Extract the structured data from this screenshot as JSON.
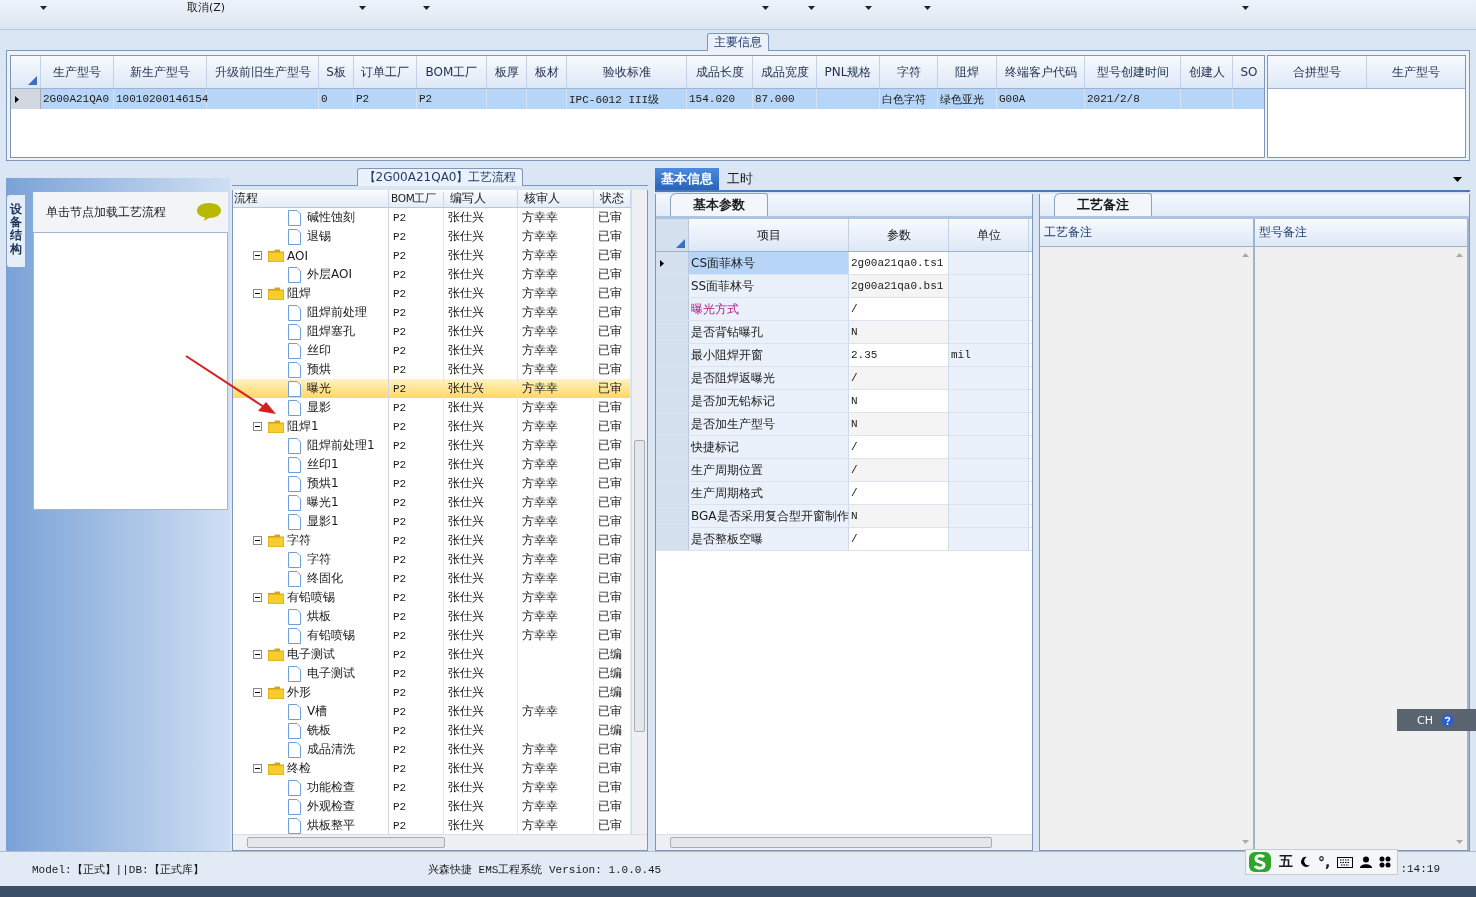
{
  "toolbar": {
    "cancel_label": "取消(Z)"
  },
  "main_info": {
    "title": "主要信息",
    "columns": [
      "生产型号",
      "新生产型号",
      "升级前旧生产型号",
      "S板",
      "订单工厂",
      "BOM工厂",
      "板厚",
      "板材",
      "验收标准",
      "成品长度",
      "成品宽度",
      "PNL规格",
      "字符",
      "阻焊",
      "终端客户代码",
      "型号创建时间",
      "创建人",
      "SO"
    ],
    "rows": [
      {
        "selected": true,
        "cells": [
          "2G00A21QA0",
          "10010200146154",
          null,
          "0",
          "P2",
          "P2",
          null,
          null,
          "IPC-6012 III级",
          "154.020",
          "87.000",
          null,
          "白色字符",
          "绿色亚光",
          "G00A",
          "2021/2/8",
          null,
          null
        ]
      }
    ],
    "merge_columns": [
      "合拼型号",
      "生产型号"
    ]
  },
  "left_panel": {
    "vertical_tab": "设备结构",
    "hint": "单击节点加载工艺流程"
  },
  "process_tree": {
    "title": "【2G00A21QA0】工艺流程",
    "columns": [
      "流程",
      "BOM工厂",
      "编写人",
      "核审人",
      "状态"
    ],
    "nodes": [
      {
        "name": "碱性蚀刻",
        "bom_factory": "P2",
        "writer": "张仕兴",
        "reviewer": "方幸幸",
        "status": "已审",
        "selected": false
      },
      {
        "name": "退锡",
        "bom_factory": "P2",
        "writer": "张仕兴",
        "reviewer": "方幸幸",
        "status": "已审",
        "selected": false
      },
      {
        "name": "AOI",
        "bom_factory": "P2",
        "writer": "张仕兴",
        "reviewer": "方幸幸",
        "status": "已审",
        "selected": false,
        "expanded": true,
        "children": [
          {
            "name": "外层AOI",
            "bom_factory": "P2",
            "writer": "张仕兴",
            "reviewer": "方幸幸",
            "status": "已审",
            "selected": false
          }
        ]
      },
      {
        "name": "阻焊",
        "bom_factory": "P2",
        "writer": "张仕兴",
        "reviewer": "方幸幸",
        "status": "已审",
        "selected": false,
        "expanded": true,
        "children": [
          {
            "name": "阻焊前处理",
            "bom_factory": "P2",
            "writer": "张仕兴",
            "reviewer": "方幸幸",
            "status": "已审",
            "selected": false
          },
          {
            "name": "阻焊塞孔",
            "bom_factory": "P2",
            "writer": "张仕兴",
            "reviewer": "方幸幸",
            "status": "已审",
            "selected": false
          },
          {
            "name": "丝印",
            "bom_factory": "P2",
            "writer": "张仕兴",
            "reviewer": "方幸幸",
            "status": "已审",
            "selected": false
          },
          {
            "name": "预烘",
            "bom_factory": "P2",
            "writer": "张仕兴",
            "reviewer": "方幸幸",
            "status": "已审",
            "selected": false
          },
          {
            "name": "曝光",
            "bom_factory": "P2",
            "writer": "张仕兴",
            "reviewer": "方幸幸",
            "status": "已审",
            "selected": true
          },
          {
            "name": "显影",
            "bom_factory": "P2",
            "writer": "张仕兴",
            "reviewer": "方幸幸",
            "status": "已审",
            "selected": false
          }
        ]
      },
      {
        "name": "阻焊1",
        "bom_factory": "P2",
        "writer": "张仕兴",
        "reviewer": "方幸幸",
        "status": "已审",
        "selected": false,
        "expanded": true,
        "children": [
          {
            "name": "阻焊前处理1",
            "bom_factory": "P2",
            "writer": "张仕兴",
            "reviewer": "方幸幸",
            "status": "已审",
            "selected": false
          },
          {
            "name": "丝印1",
            "bom_factory": "P2",
            "writer": "张仕兴",
            "reviewer": "方幸幸",
            "status": "已审",
            "selected": false
          },
          {
            "name": "预烘1",
            "bom_factory": "P2",
            "writer": "张仕兴",
            "reviewer": "方幸幸",
            "status": "已审",
            "selected": false
          },
          {
            "name": "曝光1",
            "bom_factory": "P2",
            "writer": "张仕兴",
            "reviewer": "方幸幸",
            "status": "已审",
            "selected": false
          },
          {
            "name": "显影1",
            "bom_factory": "P2",
            "writer": "张仕兴",
            "reviewer": "方幸幸",
            "status": "已审",
            "selected": false
          }
        ]
      },
      {
        "name": "字符",
        "bom_factory": "P2",
        "writer": "张仕兴",
        "reviewer": "方幸幸",
        "status": "已审",
        "selected": false,
        "expanded": true,
        "children": [
          {
            "name": "字符",
            "bom_factory": "P2",
            "writer": "张仕兴",
            "reviewer": "方幸幸",
            "status": "已审",
            "selected": false
          },
          {
            "name": "终固化",
            "bom_factory": "P2",
            "writer": "张仕兴",
            "reviewer": "方幸幸",
            "status": "已审",
            "selected": false
          }
        ]
      },
      {
        "name": "有铅喷锡",
        "bom_factory": "P2",
        "writer": "张仕兴",
        "reviewer": "方幸幸",
        "status": "已审",
        "selected": false,
        "expanded": true,
        "children": [
          {
            "name": "烘板",
            "bom_factory": "P2",
            "writer": "张仕兴",
            "reviewer": "方幸幸",
            "status": "已审",
            "selected": false
          },
          {
            "name": "有铅喷锡",
            "bom_factory": "P2",
            "writer": "张仕兴",
            "reviewer": "方幸幸",
            "status": "已审",
            "selected": false
          }
        ]
      },
      {
        "name": "电子测试",
        "bom_factory": "P2",
        "writer": "张仕兴",
        "status": "已编",
        "selected": false,
        "expanded": true,
        "children": [
          {
            "name": "电子测试",
            "bom_factory": "P2",
            "writer": "张仕兴",
            "status": "已编",
            "selected": false
          }
        ]
      },
      {
        "name": "外形",
        "bom_factory": "P2",
        "writer": "张仕兴",
        "status": "已编",
        "selected": false,
        "expanded": true,
        "children": [
          {
            "name": "V槽",
            "bom_factory": "P2",
            "writer": "张仕兴",
            "reviewer": "方幸幸",
            "status": "已审",
            "selected": false
          },
          {
            "name": "铣板",
            "bom_factory": "P2",
            "writer": "张仕兴",
            "status": "已编",
            "selected": false
          },
          {
            "name": "成品清洗",
            "bom_factory": "P2",
            "writer": "张仕兴",
            "reviewer": "方幸幸",
            "status": "已审",
            "selected": false
          }
        ]
      },
      {
        "name": "终检",
        "bom_factory": "P2",
        "writer": "张仕兴",
        "reviewer": "方幸幸",
        "status": "已审",
        "selected": false,
        "expanded": true,
        "children": [
          {
            "name": "功能检查",
            "bom_factory": "P2",
            "writer": "张仕兴",
            "reviewer": "方幸幸",
            "status": "已审",
            "selected": false
          },
          {
            "name": "外观检查",
            "bom_factory": "P2",
            "writer": "张仕兴",
            "reviewer": "方幸幸",
            "status": "已审",
            "selected": false
          },
          {
            "name": "烘板整平",
            "bom_factory": "P2",
            "writer": "张仕兴",
            "reviewer": "方幸幸",
            "status": "已审",
            "selected": false
          }
        ]
      }
    ]
  },
  "detail_tabs": [
    {
      "label": "基本信息",
      "selected": true
    },
    {
      "label": "工时",
      "selected": false
    }
  ],
  "basic_params": {
    "tab": "基本参数",
    "columns": [
      "项目",
      "参数",
      "单位"
    ],
    "rows": [
      {
        "item": "CS面菲林号",
        "value": "2g00a21qa0.ts1",
        "selected": true,
        "highlighted": false
      },
      {
        "item": "SS面菲林号",
        "value": "2g00a21qa0.bs1",
        "selected": false,
        "highlighted": false
      },
      {
        "item": "曝光方式",
        "value": "/",
        "selected": false,
        "highlighted": true
      },
      {
        "item": "是否背钻曝孔",
        "value": "N",
        "selected": false,
        "highlighted": false
      },
      {
        "item": "最小阻焊开窗",
        "value": "2.35",
        "unit": "mil",
        "selected": false,
        "highlighted": false
      },
      {
        "item": "是否阻焊返曝光",
        "value": "/",
        "selected": false,
        "highlighted": false
      },
      {
        "item": "是否加无铅标记",
        "value": "N",
        "selected": false,
        "highlighted": false
      },
      {
        "item": "是否加生产型号",
        "value": "N",
        "selected": false,
        "highlighted": false
      },
      {
        "item": "快捷标记",
        "value": "/",
        "selected": false,
        "highlighted": false
      },
      {
        "item": "生产周期位置",
        "value": "/",
        "selected": false,
        "highlighted": false
      },
      {
        "item": "生产周期格式",
        "value": "/",
        "selected": false,
        "highlighted": false
      },
      {
        "item": "BGA是否采用复合型开窗制作",
        "value": "N",
        "selected": false,
        "highlighted": false
      },
      {
        "item": "是否整板空曝",
        "value": "/",
        "selected": false,
        "highlighted": false
      }
    ]
  },
  "process_notes": {
    "tab": "工艺备注",
    "columns": [
      "工艺备注",
      "型号备注"
    ]
  },
  "status_bar": {
    "model": "Model:【正式】||DB:【正式库】",
    "app": "兴森快捷 EMS工程系统 Version: 1.0.0.45",
    "clock": ":14:19"
  },
  "ime_bar": {
    "mode": "五",
    "punctuation": "°,"
  },
  "language_bar": {
    "label": "CH"
  }
}
